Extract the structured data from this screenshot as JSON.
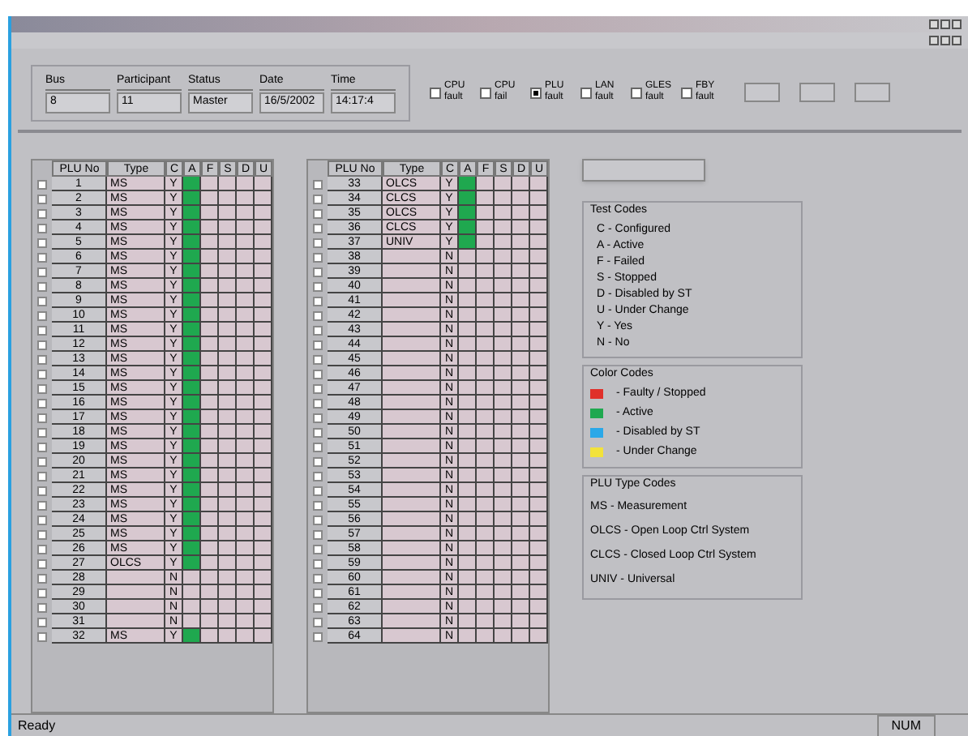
{
  "header": {
    "fields": [
      {
        "label": "Bus",
        "value": "8"
      },
      {
        "label": "Participant",
        "value": "11"
      },
      {
        "label": "Status",
        "value": "Master"
      },
      {
        "label": "Date",
        "value": "16/5/2002"
      },
      {
        "label": "Time",
        "value": "14:17:4"
      }
    ],
    "checks": [
      {
        "label": "CPU fault",
        "checked": false
      },
      {
        "label": "CPU fail",
        "checked": false
      },
      {
        "label": "PLU fault",
        "checked": true
      },
      {
        "label": "LAN fault",
        "checked": false
      },
      {
        "label": "GLES fault",
        "checked": false
      },
      {
        "label": "FBY fault",
        "checked": false
      }
    ]
  },
  "tables": [
    {
      "columns": [
        "PLU No",
        "Type",
        "C",
        "A",
        "F",
        "S",
        "D",
        "U"
      ],
      "rows": [
        {
          "checked": false,
          "no": "1",
          "type": "MS",
          "c": "Y",
          "active": true
        },
        {
          "checked": false,
          "no": "2",
          "type": "MS",
          "c": "Y",
          "active": true
        },
        {
          "checked": false,
          "no": "3",
          "type": "MS",
          "c": "Y",
          "active": true
        },
        {
          "checked": false,
          "no": "4",
          "type": "MS",
          "c": "Y",
          "active": true
        },
        {
          "checked": false,
          "no": "5",
          "type": "MS",
          "c": "Y",
          "active": true
        },
        {
          "checked": false,
          "no": "6",
          "type": "MS",
          "c": "Y",
          "active": true
        },
        {
          "checked": false,
          "no": "7",
          "type": "MS",
          "c": "Y",
          "active": true
        },
        {
          "checked": false,
          "no": "8",
          "type": "MS",
          "c": "Y",
          "active": true
        },
        {
          "checked": false,
          "no": "9",
          "type": "MS",
          "c": "Y",
          "active": true
        },
        {
          "checked": false,
          "no": "10",
          "type": "MS",
          "c": "Y",
          "active": true
        },
        {
          "checked": false,
          "no": "11",
          "type": "MS",
          "c": "Y",
          "active": true
        },
        {
          "checked": false,
          "no": "12",
          "type": "MS",
          "c": "Y",
          "active": true
        },
        {
          "checked": false,
          "no": "13",
          "type": "MS",
          "c": "Y",
          "active": true
        },
        {
          "checked": false,
          "no": "14",
          "type": "MS",
          "c": "Y",
          "active": true
        },
        {
          "checked": false,
          "no": "15",
          "type": "MS",
          "c": "Y",
          "active": true
        },
        {
          "checked": false,
          "no": "16",
          "type": "MS",
          "c": "Y",
          "active": true
        },
        {
          "checked": false,
          "no": "17",
          "type": "MS",
          "c": "Y",
          "active": true
        },
        {
          "checked": false,
          "no": "18",
          "type": "MS",
          "c": "Y",
          "active": true
        },
        {
          "checked": false,
          "no": "19",
          "type": "MS",
          "c": "Y",
          "active": true
        },
        {
          "checked": false,
          "no": "20",
          "type": "MS",
          "c": "Y",
          "active": true
        },
        {
          "checked": false,
          "no": "21",
          "type": "MS",
          "c": "Y",
          "active": true
        },
        {
          "checked": false,
          "no": "22",
          "type": "MS",
          "c": "Y",
          "active": true
        },
        {
          "checked": false,
          "no": "23",
          "type": "MS",
          "c": "Y",
          "active": true
        },
        {
          "checked": false,
          "no": "24",
          "type": "MS",
          "c": "Y",
          "active": true
        },
        {
          "checked": false,
          "no": "25",
          "type": "MS",
          "c": "Y",
          "active": true
        },
        {
          "checked": false,
          "no": "26",
          "type": "MS",
          "c": "Y",
          "active": true
        },
        {
          "checked": false,
          "no": "27",
          "type": "OLCS",
          "c": "Y",
          "active": true
        },
        {
          "checked": false,
          "no": "28",
          "type": "",
          "c": "N",
          "active": false
        },
        {
          "checked": false,
          "no": "29",
          "type": "",
          "c": "N",
          "active": false
        },
        {
          "checked": false,
          "no": "30",
          "type": "",
          "c": "N",
          "active": false
        },
        {
          "checked": false,
          "no": "31",
          "type": "",
          "c": "N",
          "active": false
        },
        {
          "checked": false,
          "no": "32",
          "type": "MS",
          "c": "Y",
          "active": true
        }
      ]
    },
    {
      "columns": [
        "PLU No",
        "Type",
        "C",
        "A",
        "F",
        "S",
        "D",
        "U"
      ],
      "rows": [
        {
          "checked": false,
          "no": "33",
          "type": "OLCS",
          "c": "Y",
          "active": true
        },
        {
          "checked": false,
          "no": "34",
          "type": "CLCS",
          "c": "Y",
          "active": true
        },
        {
          "checked": false,
          "no": "35",
          "type": "OLCS",
          "c": "Y",
          "active": true
        },
        {
          "checked": false,
          "no": "36",
          "type": "CLCS",
          "c": "Y",
          "active": true
        },
        {
          "checked": false,
          "no": "37",
          "type": "UNIV",
          "c": "Y",
          "active": true
        },
        {
          "checked": false,
          "no": "38",
          "type": "",
          "c": "N",
          "active": false
        },
        {
          "checked": false,
          "no": "39",
          "type": "",
          "c": "N",
          "active": false
        },
        {
          "checked": false,
          "no": "40",
          "type": "",
          "c": "N",
          "active": false
        },
        {
          "checked": false,
          "no": "41",
          "type": "",
          "c": "N",
          "active": false
        },
        {
          "checked": false,
          "no": "42",
          "type": "",
          "c": "N",
          "active": false
        },
        {
          "checked": false,
          "no": "43",
          "type": "",
          "c": "N",
          "active": false
        },
        {
          "checked": false,
          "no": "44",
          "type": "",
          "c": "N",
          "active": false
        },
        {
          "checked": false,
          "no": "45",
          "type": "",
          "c": "N",
          "active": false
        },
        {
          "checked": false,
          "no": "46",
          "type": "",
          "c": "N",
          "active": false
        },
        {
          "checked": false,
          "no": "47",
          "type": "",
          "c": "N",
          "active": false
        },
        {
          "checked": false,
          "no": "48",
          "type": "",
          "c": "N",
          "active": false
        },
        {
          "checked": false,
          "no": "49",
          "type": "",
          "c": "N",
          "active": false
        },
        {
          "checked": false,
          "no": "50",
          "type": "",
          "c": "N",
          "active": false
        },
        {
          "checked": false,
          "no": "51",
          "type": "",
          "c": "N",
          "active": false
        },
        {
          "checked": false,
          "no": "52",
          "type": "",
          "c": "N",
          "active": false
        },
        {
          "checked": false,
          "no": "53",
          "type": "",
          "c": "N",
          "active": false
        },
        {
          "checked": false,
          "no": "54",
          "type": "",
          "c": "N",
          "active": false
        },
        {
          "checked": false,
          "no": "55",
          "type": "",
          "c": "N",
          "active": false
        },
        {
          "checked": false,
          "no": "56",
          "type": "",
          "c": "N",
          "active": false
        },
        {
          "checked": false,
          "no": "57",
          "type": "",
          "c": "N",
          "active": false
        },
        {
          "checked": false,
          "no": "58",
          "type": "",
          "c": "N",
          "active": false
        },
        {
          "checked": false,
          "no": "59",
          "type": "",
          "c": "N",
          "active": false
        },
        {
          "checked": false,
          "no": "60",
          "type": "",
          "c": "N",
          "active": false
        },
        {
          "checked": false,
          "no": "61",
          "type": "",
          "c": "N",
          "active": false
        },
        {
          "checked": false,
          "no": "62",
          "type": "",
          "c": "N",
          "active": false
        },
        {
          "checked": false,
          "no": "63",
          "type": "",
          "c": "N",
          "active": false
        },
        {
          "checked": false,
          "no": "64",
          "type": "",
          "c": "N",
          "active": false
        }
      ]
    }
  ],
  "legends": [
    {
      "title": "Test Codes",
      "kind": "text",
      "items": [
        {
          "label": "C - Configured"
        },
        {
          "label": "A - Active"
        },
        {
          "label": "F - Failed"
        },
        {
          "label": "S - Stopped"
        },
        {
          "label": "D - Disabled by ST"
        },
        {
          "label": "U - Under Change"
        },
        {
          "label": "Y - Yes"
        },
        {
          "label": "N - No"
        }
      ]
    },
    {
      "title": "Color Codes",
      "kind": "color",
      "items": [
        {
          "label": "- Faulty / Stopped",
          "color": "#e0302a"
        },
        {
          "label": "- Active",
          "color": "#1fa84f"
        },
        {
          "label": "- Disabled by ST",
          "color": "#2aa8e8"
        },
        {
          "label": "- Under Change",
          "color": "#f2e23a"
        }
      ]
    },
    {
      "title": "PLU Type Codes",
      "kind": "text",
      "items": [
        {
          "label": "MS - Measurement"
        },
        {
          "label": "OLCS - Open Loop Ctrl System"
        },
        {
          "label": "CLCS - Closed Loop Ctrl System"
        },
        {
          "label": "UNIV - Universal"
        }
      ]
    }
  ],
  "status_bar": {
    "message": "Ready",
    "indicator": "NUM"
  }
}
